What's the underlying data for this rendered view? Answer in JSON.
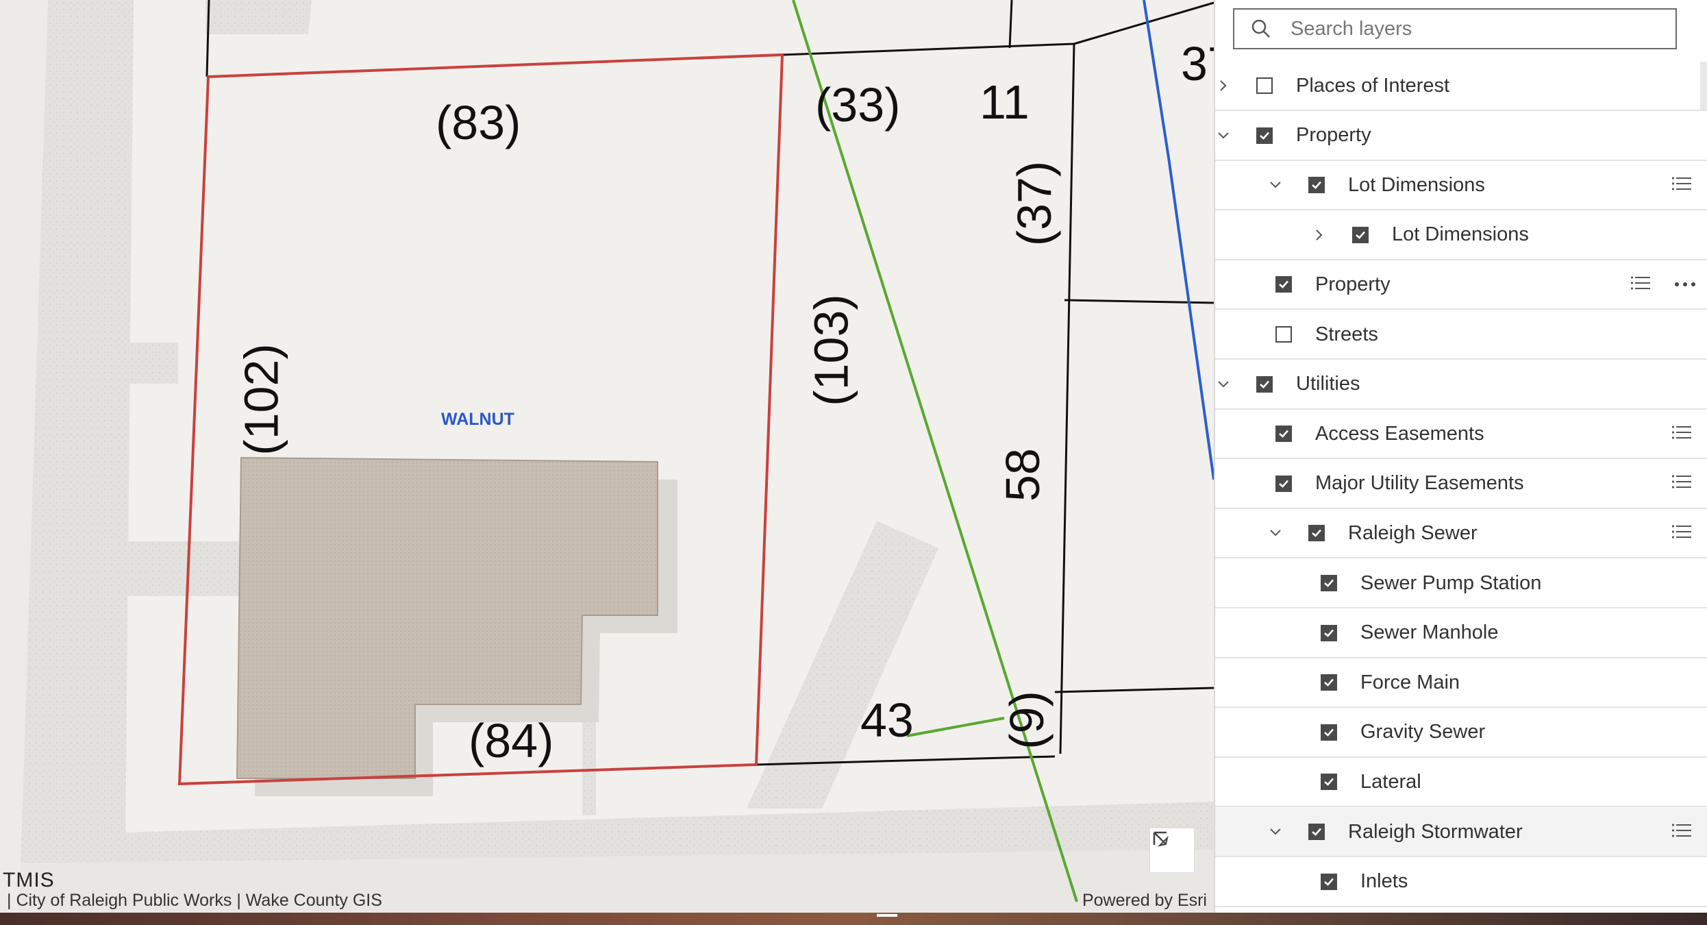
{
  "map": {
    "street_label": "WALNUT",
    "dimension_labels": {
      "lot_top": "(83)",
      "lot_left": "(102)",
      "lot_right": "(103)",
      "lot_bottom": "(84)",
      "adj_top": "(33)",
      "adj_top_right": "11",
      "adj_right": "(37)",
      "adj_middle": "58",
      "adj_bottom": "43",
      "adj_bottom_right": "(9)",
      "far_right_partial": "37"
    },
    "watermark": "TMIS",
    "attribution_left": "| City of Raleigh Public Works | Wake County GIS",
    "attribution_right": "Powered by Esri",
    "nav_icon": "cursor-arrow-icon",
    "colors": {
      "selected_parcel": "#c9413e",
      "green_line": "#5aa832",
      "blue_line": "#2b5fd0",
      "building": "#c7bcb1"
    }
  },
  "panel": {
    "search": {
      "placeholder": "Search layers"
    },
    "layers": [
      {
        "label": "Places of Interest",
        "checked": false,
        "chevron": "right",
        "indent": 0,
        "list": false,
        "more": false
      },
      {
        "label": "Property",
        "checked": true,
        "chevron": "down",
        "indent": 0,
        "list": false,
        "more": false
      },
      {
        "label": "Lot Dimensions",
        "checked": true,
        "chevron": "down",
        "indent": 1,
        "list": true,
        "more": false
      },
      {
        "label": "Lot Dimensions",
        "checked": true,
        "chevron": "right",
        "indent": 2,
        "list": false,
        "more": false
      },
      {
        "label": "Property",
        "checked": true,
        "chevron": "none",
        "indent": 1,
        "list": true,
        "more": true
      },
      {
        "label": "Streets",
        "checked": false,
        "chevron": "none",
        "indent": 1,
        "list": false,
        "more": false
      },
      {
        "label": "Utilities",
        "checked": true,
        "chevron": "down",
        "indent": 0,
        "list": false,
        "more": false
      },
      {
        "label": "Access Easements",
        "checked": true,
        "chevron": "none",
        "indent": 1,
        "list": true,
        "more": false
      },
      {
        "label": "Major Utility Easements",
        "checked": true,
        "chevron": "none",
        "indent": 1,
        "list": true,
        "more": false
      },
      {
        "label": "Raleigh Sewer",
        "checked": true,
        "chevron": "down",
        "indent": 1,
        "list": true,
        "more": false
      },
      {
        "label": "Sewer Pump Station",
        "checked": true,
        "chevron": "none",
        "indent": 2,
        "list": false,
        "more": false
      },
      {
        "label": "Sewer Manhole",
        "checked": true,
        "chevron": "none",
        "indent": 2,
        "list": false,
        "more": false
      },
      {
        "label": "Force Main",
        "checked": true,
        "chevron": "none",
        "indent": 2,
        "list": false,
        "more": false
      },
      {
        "label": "Gravity Sewer",
        "checked": true,
        "chevron": "none",
        "indent": 2,
        "list": false,
        "more": false
      },
      {
        "label": "Lateral",
        "checked": true,
        "chevron": "none",
        "indent": 2,
        "list": false,
        "more": false
      },
      {
        "label": "Raleigh Stormwater",
        "checked": true,
        "chevron": "down",
        "indent": 1,
        "list": true,
        "more": false,
        "highlight": true
      },
      {
        "label": "Inlets",
        "checked": true,
        "chevron": "none",
        "indent": 2,
        "list": false,
        "more": false
      }
    ]
  }
}
